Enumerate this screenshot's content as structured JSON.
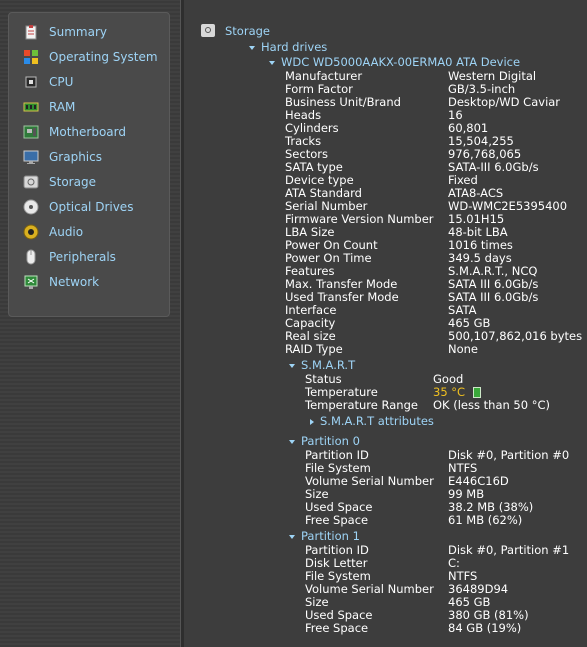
{
  "sidebar": {
    "items": [
      {
        "label": "Summary",
        "icon": "clipboard-icon"
      },
      {
        "label": "Operating System",
        "icon": "windows-flag-icon"
      },
      {
        "label": "CPU",
        "icon": "cpu-chip-icon"
      },
      {
        "label": "RAM",
        "icon": "ram-module-icon"
      },
      {
        "label": "Motherboard",
        "icon": "motherboard-icon"
      },
      {
        "label": "Graphics",
        "icon": "monitor-icon"
      },
      {
        "label": "Storage",
        "icon": "hard-drive-icon"
      },
      {
        "label": "Optical Drives",
        "icon": "optical-disc-icon"
      },
      {
        "label": "Audio",
        "icon": "speaker-icon"
      },
      {
        "label": "Peripherals",
        "icon": "mouse-icon"
      },
      {
        "label": "Network",
        "icon": "network-icon"
      }
    ]
  },
  "tree": {
    "root_label": "Storage",
    "hard_drives_label": "Hard drives",
    "device_label": "WDC WD5000AAKX-00ERMA0 ATA Device",
    "device_props": [
      {
        "key": "Manufacturer",
        "value": "Western Digital"
      },
      {
        "key": "Form Factor",
        "value": "GB/3.5-inch"
      },
      {
        "key": "Business Unit/Brand",
        "value": "Desktop/WD Caviar"
      },
      {
        "key": "Heads",
        "value": "16"
      },
      {
        "key": "Cylinders",
        "value": "60,801"
      },
      {
        "key": "Tracks",
        "value": "15,504,255"
      },
      {
        "key": "Sectors",
        "value": "976,768,065"
      },
      {
        "key": "SATA type",
        "value": "SATA-III 6.0Gb/s"
      },
      {
        "key": "Device type",
        "value": "Fixed"
      },
      {
        "key": "ATA Standard",
        "value": "ATA8-ACS"
      },
      {
        "key": "Serial Number",
        "value": "WD-WMC2E5395400"
      },
      {
        "key": "Firmware Version Number",
        "value": "15.01H15"
      },
      {
        "key": "LBA Size",
        "value": "48-bit LBA"
      },
      {
        "key": "Power On Count",
        "value": "1016 times"
      },
      {
        "key": "Power On Time",
        "value": "349.5 days"
      },
      {
        "key": "Features",
        "value": "S.M.A.R.T., NCQ"
      },
      {
        "key": "Max. Transfer Mode",
        "value": "SATA III 6.0Gb/s"
      },
      {
        "key": "Used Transfer Mode",
        "value": "SATA III 6.0Gb/s"
      },
      {
        "key": "Interface",
        "value": "SATA"
      },
      {
        "key": "Capacity",
        "value": "465 GB"
      },
      {
        "key": "Real size",
        "value": "500,107,862,016 bytes"
      },
      {
        "key": "RAID Type",
        "value": "None"
      }
    ],
    "smart": {
      "label": "S.M.A.R.T",
      "status_key": "Status",
      "status_value": "Good",
      "temp_key": "Temperature",
      "temp_value": "35 °C",
      "temp_range_key": "Temperature Range",
      "temp_range_value": "OK (less than 50 °C)",
      "attributes_label": "S.M.A.R.T attributes"
    },
    "partitions": [
      {
        "label": "Partition 0",
        "props": [
          {
            "key": "Partition ID",
            "value": "Disk #0, Partition #0"
          },
          {
            "key": "File System",
            "value": "NTFS"
          },
          {
            "key": "Volume Serial Number",
            "value": "E446C16D"
          },
          {
            "key": "Size",
            "value": "99 MB"
          },
          {
            "key": "Used Space",
            "value": "38.2 MB (38%)"
          },
          {
            "key": "Free Space",
            "value": "61 MB (62%)"
          }
        ]
      },
      {
        "label": "Partition 1",
        "props": [
          {
            "key": "Partition ID",
            "value": "Disk #0, Partition #1"
          },
          {
            "key": "Disk Letter",
            "value": "C:"
          },
          {
            "key": "File System",
            "value": "NTFS"
          },
          {
            "key": "Volume Serial Number",
            "value": "36489D94"
          },
          {
            "key": "Size",
            "value": "465 GB"
          },
          {
            "key": "Used Space",
            "value": "380 GB (81%)"
          },
          {
            "key": "Free Space",
            "value": "84 GB (19%)"
          }
        ]
      }
    ]
  },
  "colors": {
    "link": "#9ed4f6",
    "temperature": "#f0c020",
    "background": "#3d3d3d"
  }
}
